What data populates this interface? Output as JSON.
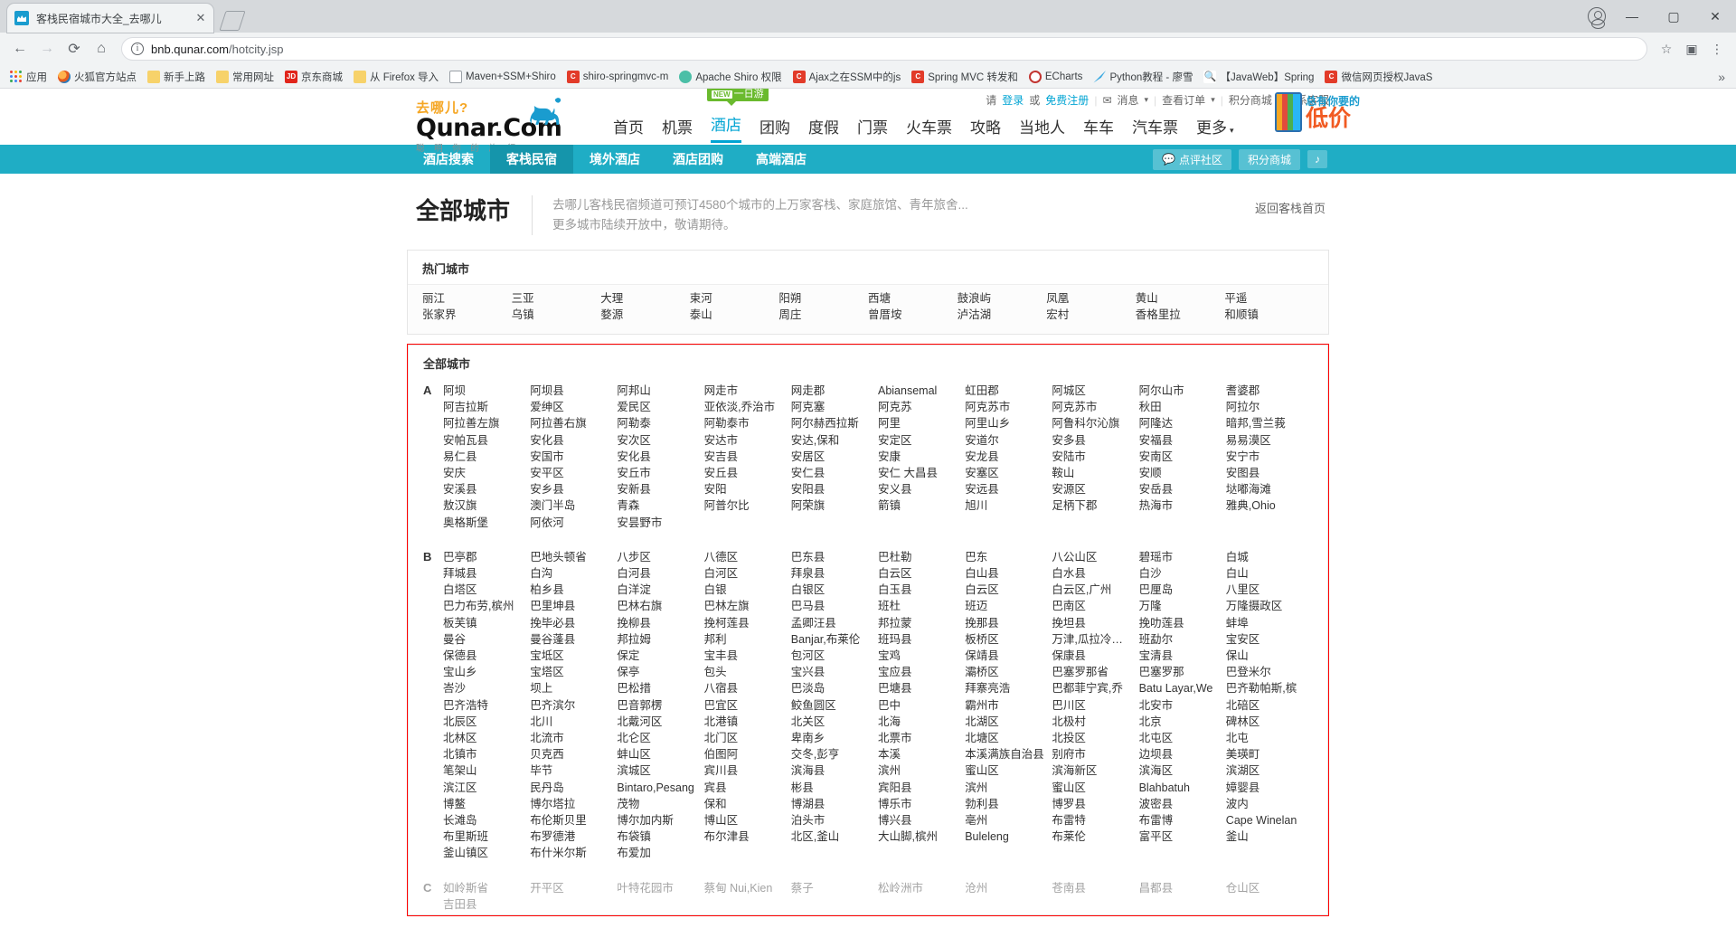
{
  "browser": {
    "tab_title": "客栈民宿城市大全_去哪儿",
    "tab_close": "✕",
    "url_main": "bnb.qunar.com",
    "url_path": "/hotcity.jsp",
    "back_icon": "←",
    "forward_icon": "→",
    "reload_icon": "⟳",
    "home_icon": "⌂",
    "star_icon": "☆",
    "ext_icon": "▣",
    "menu_icon": "⋮",
    "minimize": "—",
    "maximize": "▢",
    "close": "✕",
    "overflow": "»",
    "bookmarks": [
      {
        "label": "应用",
        "icon": "grid-icon"
      },
      {
        "label": "火狐官方站点",
        "icon": "firefox-icon"
      },
      {
        "label": "新手上路",
        "icon": "folder-icon"
      },
      {
        "label": "常用网址",
        "icon": "folder-icon"
      },
      {
        "label": "京东商城",
        "icon": "jd-icon"
      },
      {
        "label": "从 Firefox 导入",
        "icon": "folder-icon"
      },
      {
        "label": "Maven+SSM+Shiro",
        "icon": "doc-icon"
      },
      {
        "label": "shiro-springmvc-m",
        "icon": "csdn-icon"
      },
      {
        "label": "Apache Shiro 权限",
        "icon": "shiro-icon"
      },
      {
        "label": "Ajax之在SSM中的js",
        "icon": "csdn-icon"
      },
      {
        "label": "Spring MVC 转发和",
        "icon": "csdn-icon"
      },
      {
        "label": "ECharts",
        "icon": "echarts-icon"
      },
      {
        "label": "Python教程 - 廖雪",
        "icon": "python-icon"
      },
      {
        "label": "【JavaWeb】Spring",
        "icon": "search-icon"
      },
      {
        "label": "微信网页授权JavaS",
        "icon": "wechat-icon"
      }
    ]
  },
  "site": {
    "logo_slogan": "去哪儿?",
    "logo_brand": "Qunar.Com",
    "logo_tiny": "聪 明 你 的 旅 行",
    "login_prefix": "请",
    "login": "登录",
    "or": "或",
    "register": "免费注册",
    "message": "消息",
    "message_icon": "envelope-icon",
    "orders": "查看订单",
    "points_mall": "积分商城",
    "contact": "联系客服",
    "new_badge_tag": "NEW",
    "new_badge_text": "一日游",
    "ad_line1": "总有你要的",
    "ad_line2": "低价",
    "mainnav": [
      {
        "label": "首页",
        "active": false
      },
      {
        "label": "机票",
        "active": false
      },
      {
        "label": "酒店",
        "active": true
      },
      {
        "label": "团购",
        "active": false
      },
      {
        "label": "度假",
        "active": false
      },
      {
        "label": "门票",
        "active": false
      },
      {
        "label": "火车票",
        "active": false
      },
      {
        "label": "攻略",
        "active": false
      },
      {
        "label": "当地人",
        "active": false
      },
      {
        "label": "车车",
        "active": false
      },
      {
        "label": "汽车票",
        "active": false
      },
      {
        "label": "更多",
        "active": false
      }
    ],
    "subnav": [
      {
        "label": "酒店搜索",
        "active": false
      },
      {
        "label": "客栈民宿",
        "active": true
      },
      {
        "label": "境外酒店",
        "active": false
      },
      {
        "label": "酒店团购",
        "active": false
      },
      {
        "label": "高端酒店",
        "active": false
      }
    ],
    "subnav_right": {
      "community": "点评社区",
      "community_icon": "comment-icon",
      "points": "积分商城",
      "bell_icon": "♪"
    }
  },
  "main": {
    "page_title": "全部城市",
    "desc_line1": "去哪儿客栈民宿频道可预订4580个城市的上万家客栈、家庭旅馆、青年旅舍...",
    "desc_line2": "更多城市陆续开放中，敬请期待。",
    "back_link": "返回客栈首页",
    "hot_title": "热门城市",
    "hot_cities": [
      "丽江",
      "三亚",
      "大理",
      "束河",
      "阳朔",
      "西塘",
      "鼓浪屿",
      "凤凰",
      "黄山",
      "平遥",
      "张家界",
      "乌镇",
      "婺源",
      "泰山",
      "周庄",
      "曾厝垵",
      "泸沽湖",
      "宏村",
      "香格里拉",
      "和顺镇"
    ],
    "all_title": "全部城市",
    "letters": [
      {
        "letter": "A",
        "cities": [
          "阿坝",
          "阿坝县",
          "阿邦山",
          "网走市",
          "网走郡",
          "Abiansemal",
          "虹田郡",
          "阿城区",
          "阿尔山市",
          "耆婆郡",
          "阿吉拉斯",
          "爱绅区",
          "爱民区",
          "亚依淡,乔治市",
          "阿克塞",
          "阿克苏",
          "阿克苏市",
          "阿克苏市",
          "秋田",
          "阿拉尔",
          "阿拉善左旗",
          "阿拉善右旗",
          "阿勒泰",
          "阿勒泰市",
          "阿尔赫西拉斯",
          "阿里",
          "阿里山乡",
          "阿鲁科尔沁旗",
          "阿隆达",
          "暗邦,雪兰莪",
          "安帕瓦县",
          "安化县",
          "安次区",
          "安达市",
          "安达,保和",
          "安定区",
          "安道尔",
          "安多县",
          "安福县",
          "易易漠区",
          "易仁县",
          "安国市",
          "安化县",
          "安吉县",
          "安居区",
          "安康",
          "安龙县",
          "安陆市",
          "安南区",
          "安宁市",
          "安庆",
          "安平区",
          "安丘市",
          "安丘县",
          "安仁县",
          "安仁 大昌县",
          "安塞区",
          "鞍山",
          "安顺",
          "安图县",
          "安溪县",
          "安乡县",
          "安新县",
          "安阳",
          "安阳县",
          "安义县",
          "安远县",
          "安源区",
          "安岳县",
          "垯嘟海滩",
          "敖汉旗",
          "澳门半岛",
          "青森",
          "阿普尔比",
          "阿荣旗",
          "箭镇",
          "旭川",
          "足柄下郡",
          "热海市",
          "雅典,Ohio",
          "奥格斯堡",
          "阿依河",
          "安昙野市",
          "",
          "",
          "",
          "",
          ""
        ]
      },
      {
        "letter": "B",
        "cities": [
          "巴亭郡",
          "巴地头顿省",
          "八步区",
          "八德区",
          "巴东县",
          "巴杜勒",
          "巴东",
          "八公山区",
          "碧瑶市",
          "白城",
          "拜城县",
          "白沟",
          "白河县",
          "白河区",
          "拜泉县",
          "白云区",
          "白山县",
          "白水县",
          "白沙",
          "白山",
          "白塔区",
          "柏乡县",
          "白洋淀",
          "白银",
          "白银区",
          "白玉县",
          "白云区",
          "白云区,广州",
          "巴厘岛",
          "八里区",
          "巴力布劳,槟州",
          "巴里坤县",
          "巴林右旗",
          "巴林左旗",
          "巴马县",
          "班杜",
          "班迈",
          "巴南区",
          "万隆",
          "万隆摄政区",
          "板芙镇",
          "挽毕必县",
          "挽柳县",
          "挽柯莲县",
          "孟卿汪县",
          "邦拉蒙",
          "挽那县",
          "挽坦县",
          "挽叻莲县",
          "蚌埠",
          "曼谷",
          "曼谷蓬县",
          "邦拉姆",
          "邦利",
          "Banjar,布莱伦",
          "班玛县",
          "板桥区",
          "万津,瓜拉冷岳县",
          "班勐尔",
          "宝安区",
          "保德县",
          "宝坻区",
          "保定",
          "宝丰县",
          "包河区",
          "宝鸡",
          "保靖县",
          "保康县",
          "宝清县",
          "保山",
          "宝山乡",
          "宝塔区",
          "保亭",
          "包头",
          "宝兴县",
          "宝应县",
          "灞桥区",
          "巴塞罗那省",
          "巴塞罗那",
          "巴登米尔",
          "峇沙",
          "坝上",
          "巴松措",
          "八宿县",
          "巴淡岛",
          "巴塘县",
          "拜寨亮浩",
          "巴都菲宁宾,乔",
          "Batu Layar,We",
          "巴齐勒帕斯,槟",
          "巴齐浩特",
          "巴齐滨尔",
          "巴音郭楞",
          "巴宜区",
          "鲛鱼圆区",
          "巴中",
          "霸州市",
          "巴川区",
          "北安市",
          "北碚区",
          "北辰区",
          "北川",
          "北戴河区",
          "北港镇",
          "北关区",
          "北海",
          "北湖区",
          "北极村",
          "北京",
          "碑林区",
          "北林区",
          "北流市",
          "北仑区",
          "北门区",
          "卑南乡",
          "北票市",
          "北塘区",
          "北投区",
          "北屯区",
          "北屯",
          "北镇市",
          "贝克西",
          "蚌山区",
          "伯图阿",
          "交冬,彭亨",
          "本溪",
          "本溪满族自治县",
          "别府市",
          "边坝县",
          "美瑛町",
          "笔架山",
          "毕节",
          "滨城区",
          "宾川县",
          "滨海县",
          "滨州",
          "蜜山区",
          "滨海新区",
          "滨海区",
          "滨湖区",
          "滨江区",
          "民丹岛",
          "Bintaro,Pesang",
          "宾县",
          "彬县",
          "宾阳县",
          "滨州",
          "蜜山区",
          "Blahbatuh",
          "嫜婴县",
          "博鳌",
          "博尔塔拉",
          "茂物",
          "保和",
          "博湖县",
          "博乐市",
          "勃利县",
          "博罗县",
          "波密县",
          "波内",
          "长滩岛",
          "布伦斯贝里",
          "博尔加内斯",
          "博山区",
          "泊头市",
          "博兴县",
          "亳州",
          "布雷特",
          "布雷博",
          "Cape Winelan",
          "布里斯班",
          "布罗德港",
          "布袋镇",
          "布尔津县",
          "北区,釜山",
          "大山脚,槟州",
          "Buleleng",
          "布莱伦",
          "富平区",
          "釜山",
          "釜山镇区",
          "布什米尔斯",
          "布爱加",
          "",
          "",
          ""
        ]
      },
      {
        "letter": "C",
        "cities": [
          "如岭斯省",
          "开平区",
          "叶特花园市",
          "蔡甸 Nui,Kien",
          "蔡子",
          "松岭洲市",
          "沧州",
          "苍南县",
          "昌都县",
          "仓山区",
          "吉田县"
        ]
      }
    ]
  }
}
